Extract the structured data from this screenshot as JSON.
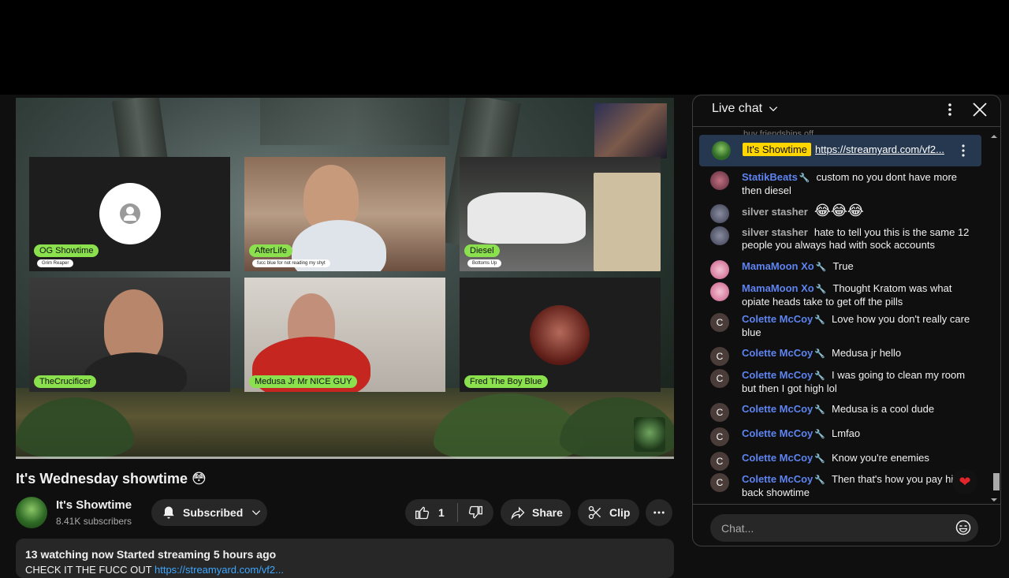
{
  "video": {
    "title": "It's Wednesday showtime 😳",
    "participants": [
      {
        "name": "OG Showtime",
        "subtitle": "Grim Reaper"
      },
      {
        "name": "AfterLife",
        "subtitle": "fucc blue for not reading my shyt"
      },
      {
        "name": "Diesel",
        "subtitle": "Bottoms Up"
      },
      {
        "name": "TheCrucificer",
        "subtitle": ""
      },
      {
        "name": "Medusa Jr Mr NICE GUY",
        "subtitle": ""
      },
      {
        "name": "Fred The Boy Blue",
        "subtitle": ""
      }
    ]
  },
  "channel": {
    "name": "It's Showtime",
    "subscribers": "8.41K subscribers",
    "subscribe_label": "Subscribed",
    "like_count": "1",
    "share_label": "Share",
    "clip_label": "Clip"
  },
  "description": {
    "stats": "13 watching now  Started streaming 5 hours ago",
    "line2_prefix": "CHECK IT THE FUCC OUT",
    "line2_link": "https://streamyard.com/vf2..."
  },
  "chat": {
    "title": "Live chat",
    "cut_message": "buy friendships off",
    "pinned": {
      "owner": "It's Showtime",
      "link": "https://streamyard.com/vf2..."
    },
    "messages": [
      {
        "author": "StatikBeats",
        "text": "custom no you dont have more then diesel"
      },
      {
        "author": "silver stasher",
        "text": "😂😂😂"
      },
      {
        "author": "silver stasher",
        "text": "hate to tell you this is the same 12 people you always had with sock accounts"
      },
      {
        "author": "MamaMoon Xo",
        "text": "True"
      },
      {
        "author": "MamaMoon Xo",
        "text": "Thought Kratom was what opiate heads take to get off the pills"
      },
      {
        "author": "Colette McCoy",
        "text": "Love how you don't really care blue"
      },
      {
        "author": "Colette McCoy",
        "text": "Medusa jr hello"
      },
      {
        "author": "Colette McCoy",
        "text": "I was going to clean my room but then I got high lol"
      },
      {
        "author": "Colette McCoy",
        "text": "Medusa is a cool dude"
      },
      {
        "author": "Colette McCoy",
        "text": "Lmfao"
      },
      {
        "author": "Colette McCoy",
        "text": "Know you're enemies"
      },
      {
        "author": "Colette McCoy",
        "text": "Then that's how you pay him back showtime"
      }
    ],
    "input_placeholder": "Chat...",
    "avatar_initial": "C"
  },
  "colors": {
    "moderator": "#5e84f1",
    "owner_badge": "#ffd600",
    "participant_tag": "#8be04e",
    "link": "#3ea6ff"
  }
}
